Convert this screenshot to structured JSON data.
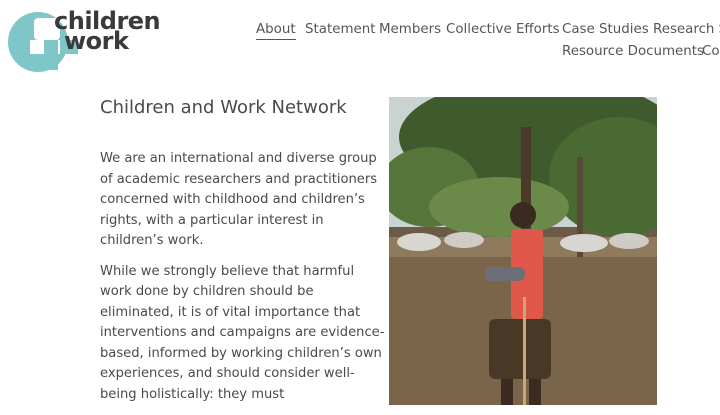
{
  "brand": {
    "logo_line1": "children",
    "logo_line2": "work",
    "logo_color": "#7fc6c8"
  },
  "nav": {
    "row1": [
      "About",
      "Statement",
      "Members",
      "Collective Efforts",
      "Case Studies",
      "Research S"
    ],
    "row2": [
      "Resource Documents",
      "Co"
    ],
    "active": "About"
  },
  "page": {
    "title": "Children and Work Network",
    "paragraphs": [
      "We are an international and diverse group of academic researchers and practitioners concerned with childhood and children’s rights, with a particular interest in children’s work.",
      "While we strongly believe that harmful work done by children should be eliminated, it is of vital importance that interventions and campaigns are evidence-based, informed by working children’s own experiences, and should consider well-being holistically: they must"
    ]
  },
  "photo": {
    "subject": "boy-herding-cattle-photo"
  }
}
